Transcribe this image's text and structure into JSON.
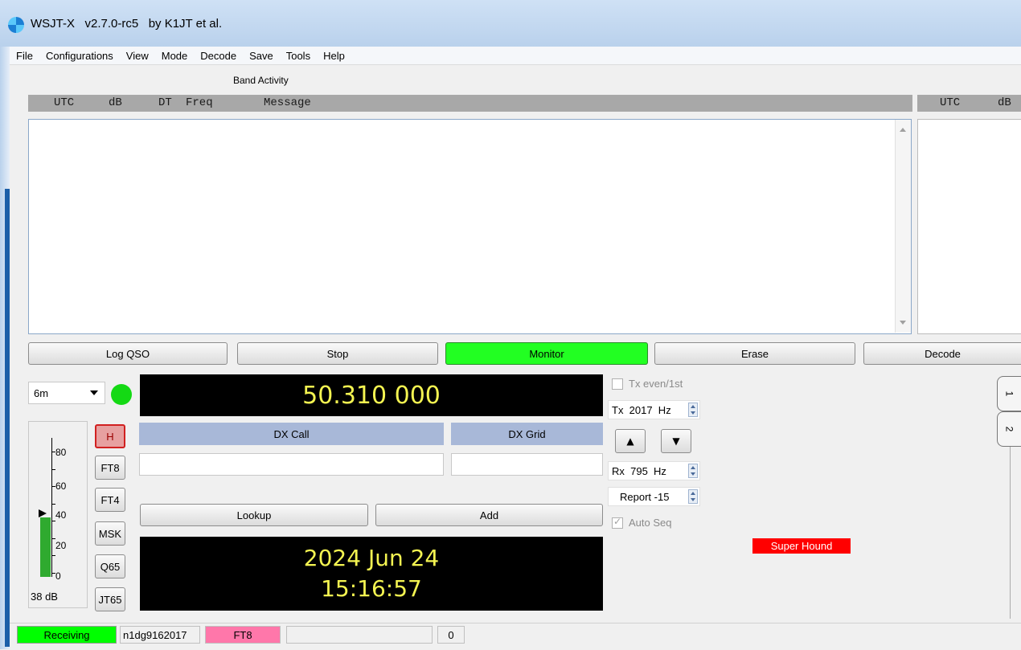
{
  "window": {
    "title": "WSJT-X   v2.7.0-rc5   by K1JT et al."
  },
  "menu": [
    "File",
    "Configurations",
    "View",
    "Mode",
    "Decode",
    "Save",
    "Tools",
    "Help"
  ],
  "band_activity": {
    "label": "Band Activity",
    "columns": [
      "UTC",
      "dB",
      "DT",
      "Freq",
      "Message"
    ]
  },
  "rx_frequency": {
    "columns": [
      "UTC",
      "dB"
    ]
  },
  "buttons": {
    "log_qso": "Log QSO",
    "stop": "Stop",
    "monitor": "Monitor",
    "erase": "Erase",
    "decode": "Decode",
    "lookup": "Lookup",
    "add": "Add"
  },
  "band": {
    "selected": "6m"
  },
  "frequency_display": "50.310 000",
  "meter": {
    "ticks": [
      "80",
      "60",
      "40",
      "20",
      "0"
    ],
    "level_db": 38,
    "level_label": "38 dB"
  },
  "modes": [
    "H",
    "FT8",
    "FT4",
    "MSK",
    "Q65",
    "JT65"
  ],
  "dx": {
    "call_label": "DX Call",
    "grid_label": "DX Grid",
    "call_value": "",
    "grid_value": ""
  },
  "clock": {
    "date": "2024 Jun 24",
    "time": "15:16:57"
  },
  "controls": {
    "tx_even_label": "Tx even/1st",
    "tx_freq": "Tx  2017  Hz",
    "rx_freq": "Rx  795  Hz",
    "report": "Report -15",
    "auto_seq_label": "Auto Seq",
    "super_hound": "Super Hound"
  },
  "side_tabs": [
    "1",
    "2"
  ],
  "status": {
    "state": "Receiving",
    "config": "n1dg9162017",
    "mode": "FT8",
    "extra": "",
    "count": "0"
  },
  "colors": {
    "monitor_active": "#22ff22",
    "receiving": "#00ff00",
    "mode_status": "#ff77aa",
    "super_hound": "#ff0000",
    "display_text": "#f4f451"
  }
}
